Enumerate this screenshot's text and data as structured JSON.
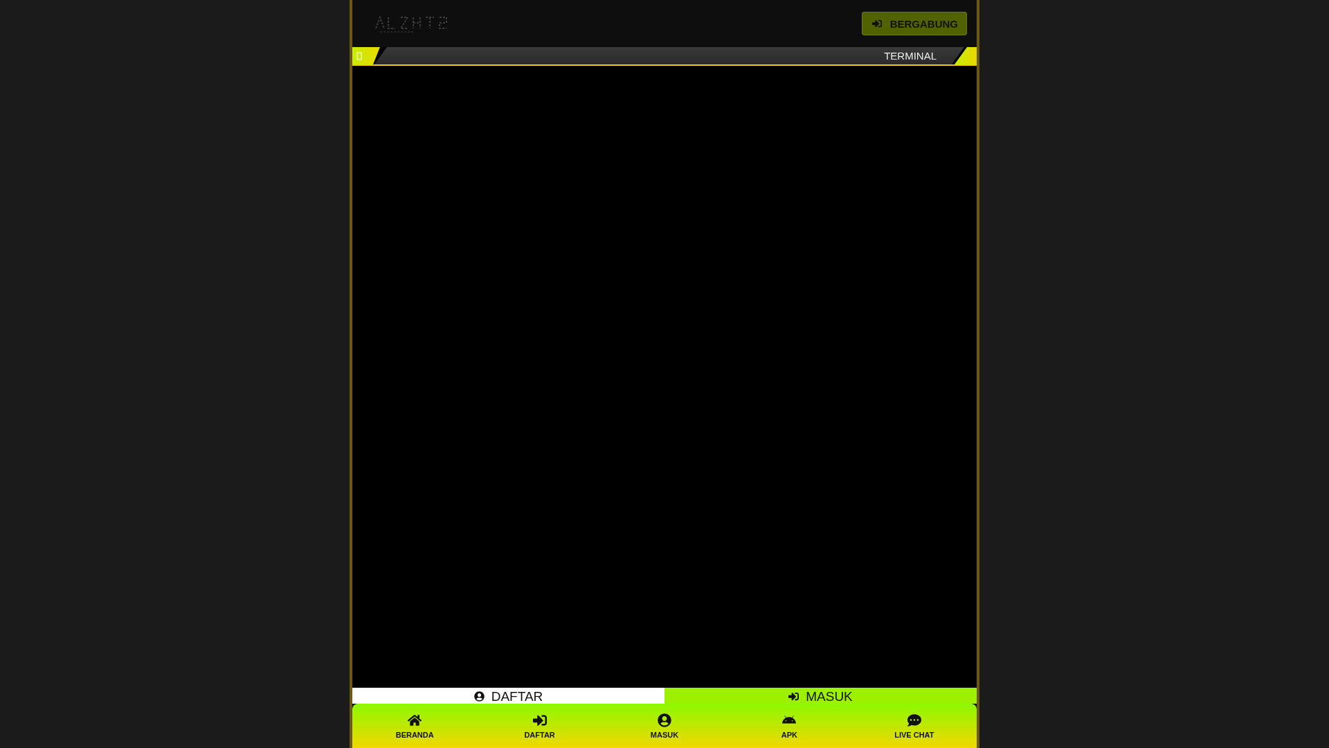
{
  "header": {
    "join_button": "BERGABUNG"
  },
  "marquee": {
    "text": "TERMINAL"
  },
  "auth_buttons": [
    {
      "label": "DAFTAR",
      "kind": "register"
    },
    {
      "label": "MASUK",
      "kind": "login"
    }
  ],
  "bottom_nav": [
    {
      "label": "BERANDA"
    },
    {
      "label": "DAFTAR"
    },
    {
      "label": "MASUK"
    },
    {
      "label": "APK"
    },
    {
      "label": "LIVE CHAT"
    }
  ]
}
